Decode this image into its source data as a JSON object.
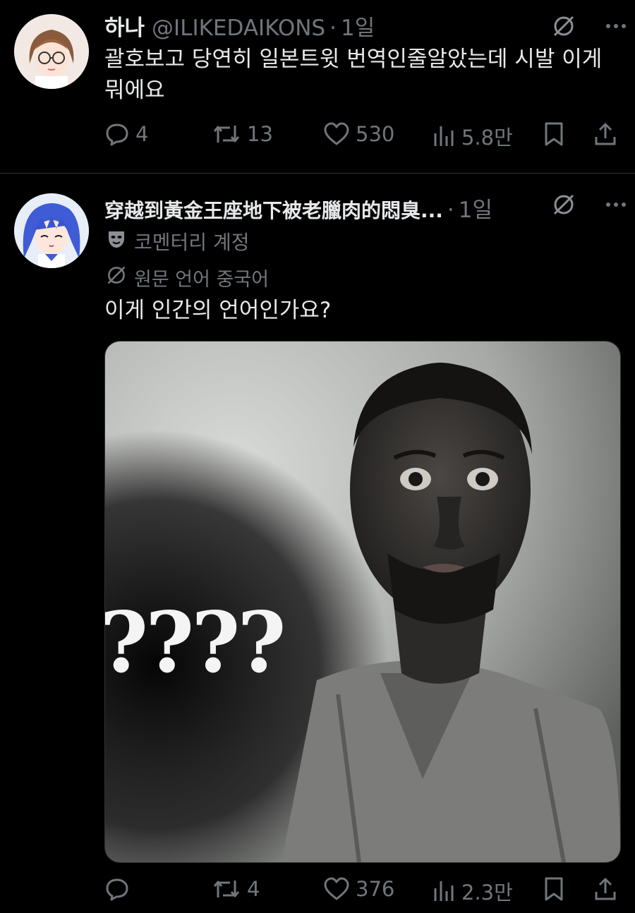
{
  "tweets": [
    {
      "name": "하나",
      "handle": "@ILIKEDAIKONS",
      "dot": "·",
      "time": "1일",
      "text": "괄호보고 당연히 일본트윗 번역인줄알았는데 시발 이게뭐에요",
      "stats": {
        "replies": "4",
        "retweets": "13",
        "likes": "530",
        "views": "5.8만"
      }
    },
    {
      "name": "穿越到黃金王座地下被老臘肉的悶臭...",
      "dot": "·",
      "time": "1일",
      "account_label": "코멘터리 계정",
      "original_language": "원문 언어 중국어",
      "text": "이게 인간의 언어인가요?",
      "media_caption": "????",
      "stats": {
        "replies": "",
        "retweets": "4",
        "likes": "376",
        "views": "2.3만"
      }
    }
  ],
  "icons": [
    "translate-off-icon",
    "more-icon",
    "reply-icon",
    "retweet-icon",
    "like-icon",
    "views-icon",
    "bookmark-icon",
    "share-icon",
    "theater-mask-icon"
  ],
  "colors": {
    "background": "#000000",
    "text": "#e7e9ea",
    "muted": "#71767b",
    "divider": "#2f3336"
  }
}
